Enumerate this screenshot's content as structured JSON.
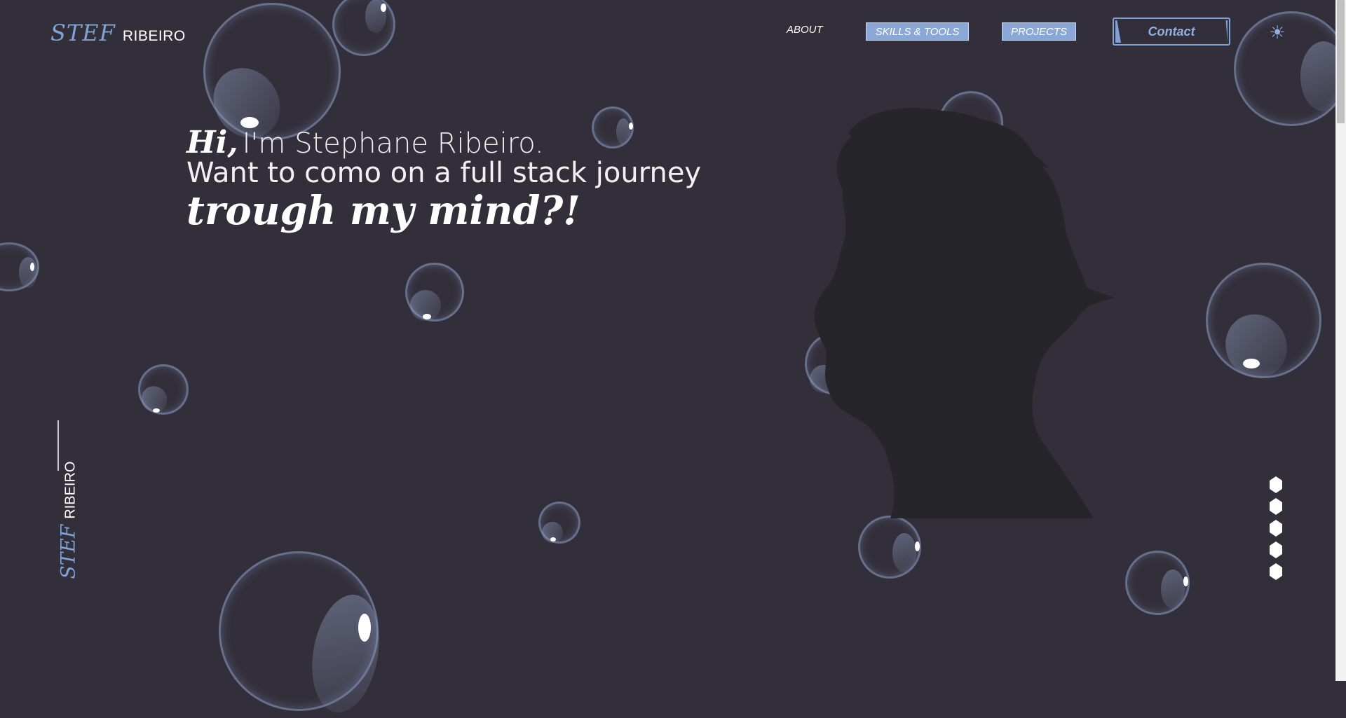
{
  "logo": {
    "mark": "STEF",
    "text": "RIBEIRO"
  },
  "nav": {
    "about": "ABOUT",
    "skills": "SKILLS & TOOLS",
    "projects": "PROJECTS",
    "contact": "Contact",
    "theme_icon": "sun-icon"
  },
  "hero": {
    "hi": "Hi,",
    "name_line": "I'm Stephane Ribeiro.",
    "line2": "Want to como on a full stack journey",
    "line3": "trough my mind?!"
  },
  "side_brand": {
    "mark": "STEF",
    "text": "RIBEIRO"
  },
  "section_dots": {
    "count": 5
  },
  "colors": {
    "background": "#332f3a",
    "accent": "#7fa3d6",
    "pill": "#8aa7d6",
    "silhouette": "#262529"
  }
}
